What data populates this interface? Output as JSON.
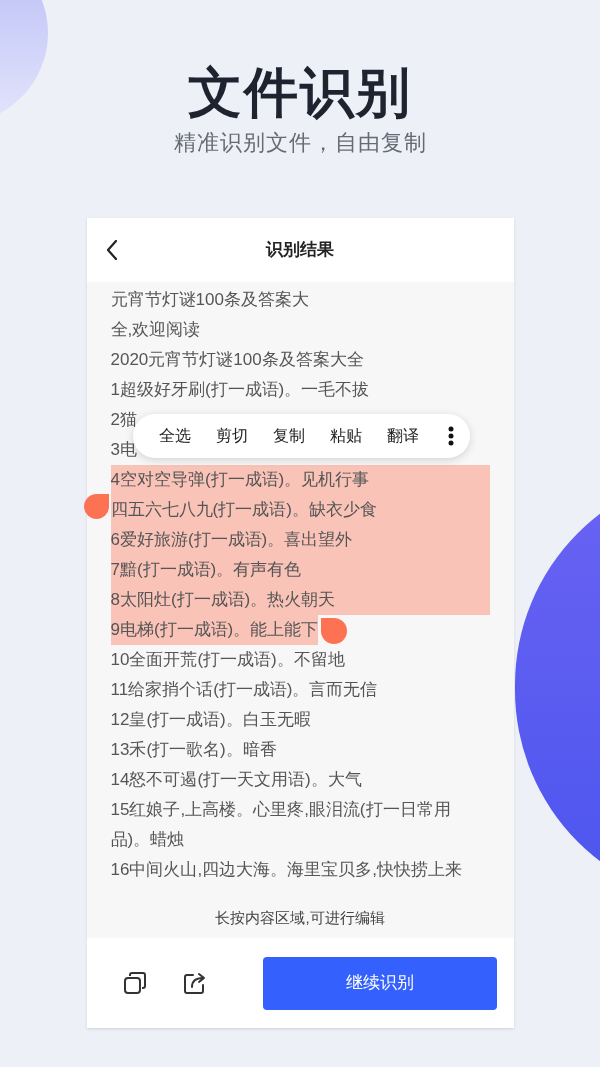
{
  "heading": {
    "title": "文件识别",
    "subtitle": "精准识别文件，自由复制"
  },
  "screen": {
    "title": "识别结果",
    "lines": [
      {
        "text": "元宵节灯谜100条及答案大",
        "selected": false
      },
      {
        "text": "全,欢迎阅读",
        "selected": false
      },
      {
        "text": "2020元宵节灯谜100条及答案大全",
        "selected": false
      },
      {
        "text": "1超级好牙刷(打一成语)。一毛不拔",
        "selected": false
      },
      {
        "text": "2猫",
        "selected": false
      },
      {
        "text": "3电",
        "selected": false
      },
      {
        "text": "4空对空导弹(打一成语)。见机行事",
        "selected": true
      },
      {
        "text": "四五六七八九(打一成语)。缺衣少食",
        "selected": true
      },
      {
        "text": "6爱好旅游(打一成语)。喜出望外",
        "selected": true
      },
      {
        "text": "7黯(打一成语)。有声有色",
        "selected": true
      },
      {
        "text": "8太阳灶(打一成语)。热火朝天",
        "selected": true
      },
      {
        "text": "9电梯(打一成语)。能上能下",
        "selected": true
      },
      {
        "text": "10全面开荒(打一成语)。不留地",
        "selected": false
      },
      {
        "text": "11给家捎个话(打一成语)。言而无信",
        "selected": false
      },
      {
        "text": "12皇(打一成语)。白玉无暇",
        "selected": false
      },
      {
        "text": "13禾(打一歌名)。暗香",
        "selected": false
      },
      {
        "text": "14怒不可遏(打一天文用语)。大气",
        "selected": false
      },
      {
        "text": "15红娘子,上高楼。心里疼,眼泪流(打一日常用",
        "selected": false
      },
      {
        "text": "品)。蜡烛",
        "selected": false
      },
      {
        "text": "16中间火山,四边大海。海里宝贝多,快快捞上来",
        "selected": false
      }
    ],
    "context_menu": [
      "全选",
      "剪切",
      "复制",
      "粘贴",
      "翻译"
    ],
    "hint": "长按内容区域,可进行编辑",
    "button": "继续识别"
  }
}
